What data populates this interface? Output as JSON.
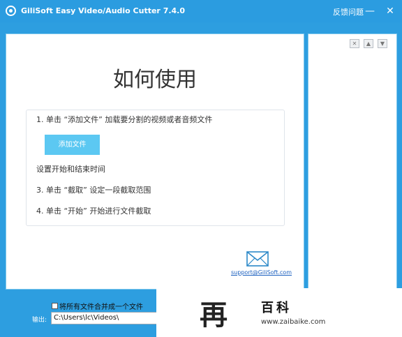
{
  "titlebar": {
    "title": "GiliSoft Easy Video/Audio Cutter 7.4.0",
    "feedback": "反馈问题",
    "minimize": "—",
    "close": "✕"
  },
  "main": {
    "heading": "如何使用",
    "steps": [
      "1. 单击 “添加文件” 加载要分割的视频或者音频文件",
      "设置开始和结束时间",
      "3. 单击 “截取” 设定一段截取范围",
      "4. 单击 “开始” 开始进行文件截取"
    ],
    "add_file_button": "添加文件",
    "support_email": "support@GiliSoft.com"
  },
  "side": {
    "buttons": [
      "✕",
      "▲",
      "▼"
    ]
  },
  "bottom": {
    "merge_label": "将所有文件合并成一个文件",
    "merge_checked": false,
    "output_label": "输出:",
    "output_path": "C:\\Users\\lc\\Videos\\"
  },
  "watermark": {
    "mark": "再",
    "text": "百科",
    "url": "www.zaibaike.com"
  },
  "colors": {
    "title_bar": "#2b9ce0",
    "accent_button": "#5cc8f2",
    "panel_border": "#7ec7ec"
  }
}
